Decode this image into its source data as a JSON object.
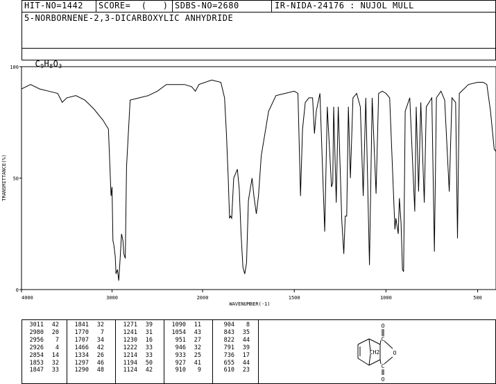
{
  "header": {
    "hit_no": "HIT-NO=1442",
    "score": "SCORE=  (   )",
    "sdbs_no": "SDBS-NO=2680",
    "ir_id": "IR-NIDA-24176 : NUJOL MULL",
    "compound_name": "5-NORBORNENE-2,3-DICARBOXYLIC ANHYDRIDE",
    "formula": {
      "c": "C",
      "c_n": "9",
      "h": "H",
      "h_n": "8",
      "o": "O",
      "o_n": "3"
    }
  },
  "chart_data": {
    "type": "line",
    "xlabel": "WAVENUMBER(-1)",
    "ylabel": "TRANSMITTANCE(%)",
    "xlim": [
      4000,
      400
    ],
    "ylim": [
      0,
      100
    ],
    "x_ticks": [
      4000,
      3000,
      2000,
      1500,
      1000,
      500
    ],
    "y_ticks": [
      0,
      50,
      100
    ],
    "grid": false,
    "series": [
      {
        "points": [
          [
            4000,
            90
          ],
          [
            3900,
            92
          ],
          [
            3800,
            90
          ],
          [
            3700,
            89
          ],
          [
            3600,
            88
          ],
          [
            3550,
            84
          ],
          [
            3500,
            86
          ],
          [
            3400,
            87
          ],
          [
            3300,
            85
          ],
          [
            3200,
            81
          ],
          [
            3100,
            76
          ],
          [
            3040,
            72
          ],
          [
            3011,
            42
          ],
          [
            3000,
            46
          ],
          [
            2990,
            22
          ],
          [
            2980,
            20
          ],
          [
            2965,
            15
          ],
          [
            2956,
            7
          ],
          [
            2940,
            9
          ],
          [
            2926,
            4
          ],
          [
            2910,
            14
          ],
          [
            2895,
            25
          ],
          [
            2880,
            22
          ],
          [
            2870,
            16
          ],
          [
            2854,
            14
          ],
          [
            2840,
            55
          ],
          [
            2800,
            85
          ],
          [
            2700,
            86
          ],
          [
            2600,
            87
          ],
          [
            2500,
            89
          ],
          [
            2400,
            92
          ],
          [
            2300,
            92
          ],
          [
            2200,
            92
          ],
          [
            2120,
            91
          ],
          [
            2080,
            89
          ],
          [
            2040,
            92
          ],
          [
            1950,
            94
          ],
          [
            1900,
            93
          ],
          [
            1880,
            86
          ],
          [
            1870,
            70
          ],
          [
            1860,
            50
          ],
          [
            1853,
            32
          ],
          [
            1847,
            33
          ],
          [
            1841,
            32
          ],
          [
            1830,
            50
          ],
          [
            1810,
            54
          ],
          [
            1800,
            45
          ],
          [
            1790,
            25
          ],
          [
            1780,
            10
          ],
          [
            1770,
            7
          ],
          [
            1760,
            12
          ],
          [
            1750,
            40
          ],
          [
            1740,
            45
          ],
          [
            1730,
            50
          ],
          [
            1720,
            42
          ],
          [
            1707,
            34
          ],
          [
            1695,
            42
          ],
          [
            1680,
            60
          ],
          [
            1660,
            70
          ],
          [
            1640,
            80
          ],
          [
            1600,
            87
          ],
          [
            1550,
            88
          ],
          [
            1500,
            89
          ],
          [
            1480,
            88
          ],
          [
            1466,
            42
          ],
          [
            1455,
            72
          ],
          [
            1440,
            84
          ],
          [
            1420,
            86
          ],
          [
            1400,
            86
          ],
          [
            1390,
            70
          ],
          [
            1380,
            80
          ],
          [
            1360,
            88
          ],
          [
            1334,
            26
          ],
          [
            1320,
            82
          ],
          [
            1297,
            46
          ],
          [
            1290,
            48
          ],
          [
            1285,
            82
          ],
          [
            1271,
            39
          ],
          [
            1260,
            82
          ],
          [
            1241,
            31
          ],
          [
            1230,
            16
          ],
          [
            1222,
            33
          ],
          [
            1214,
            33
          ],
          [
            1205,
            82
          ],
          [
            1194,
            50
          ],
          [
            1180,
            86
          ],
          [
            1160,
            88
          ],
          [
            1140,
            82
          ],
          [
            1124,
            42
          ],
          [
            1110,
            86
          ],
          [
            1090,
            11
          ],
          [
            1075,
            86
          ],
          [
            1054,
            43
          ],
          [
            1040,
            88
          ],
          [
            1020,
            89
          ],
          [
            1000,
            88
          ],
          [
            980,
            86
          ],
          [
            951,
            27
          ],
          [
            946,
            32
          ],
          [
            933,
            25
          ],
          [
            927,
            41
          ],
          [
            918,
            30
          ],
          [
            910,
            9
          ],
          [
            904,
            8
          ],
          [
            895,
            80
          ],
          [
            870,
            86
          ],
          [
            843,
            35
          ],
          [
            835,
            82
          ],
          [
            822,
            44
          ],
          [
            810,
            84
          ],
          [
            791,
            39
          ],
          [
            780,
            82
          ],
          [
            750,
            86
          ],
          [
            736,
            17
          ],
          [
            725,
            86
          ],
          [
            700,
            89
          ],
          [
            680,
            85
          ],
          [
            655,
            44
          ],
          [
            640,
            86
          ],
          [
            620,
            84
          ],
          [
            610,
            23
          ],
          [
            600,
            88
          ],
          [
            550,
            92
          ],
          [
            500,
            93
          ],
          [
            470,
            93
          ],
          [
            450,
            92
          ],
          [
            430,
            80
          ],
          [
            410,
            63
          ],
          [
            400,
            62
          ]
        ]
      }
    ]
  },
  "peaks": {
    "columns": [
      [
        [
          3011,
          42
        ],
        [
          2980,
          20
        ],
        [
          2956,
          7
        ],
        [
          2926,
          4
        ],
        [
          2854,
          14
        ],
        [
          1853,
          32
        ],
        [
          1847,
          33
        ]
      ],
      [
        [
          1841,
          32
        ],
        [
          1770,
          7
        ],
        [
          1707,
          34
        ],
        [
          1466,
          42
        ],
        [
          1334,
          26
        ],
        [
          1297,
          46
        ],
        [
          1290,
          48
        ]
      ],
      [
        [
          1271,
          39
        ],
        [
          1241,
          31
        ],
        [
          1230,
          16
        ],
        [
          1222,
          33
        ],
        [
          1214,
          33
        ],
        [
          1194,
          50
        ],
        [
          1124,
          42
        ]
      ],
      [
        [
          1090,
          11
        ],
        [
          1054,
          43
        ],
        [
          951,
          27
        ],
        [
          946,
          32
        ],
        [
          933,
          25
        ],
        [
          927,
          41
        ],
        [
          910,
          9
        ]
      ],
      [
        [
          904,
          8
        ],
        [
          843,
          35
        ],
        [
          822,
          44
        ],
        [
          791,
          39
        ],
        [
          736,
          17
        ],
        [
          655,
          44
        ],
        [
          610,
          23
        ]
      ]
    ]
  },
  "structure": {
    "labels": [
      "O",
      "C",
      "CH2",
      "O",
      "C",
      "O"
    ]
  }
}
